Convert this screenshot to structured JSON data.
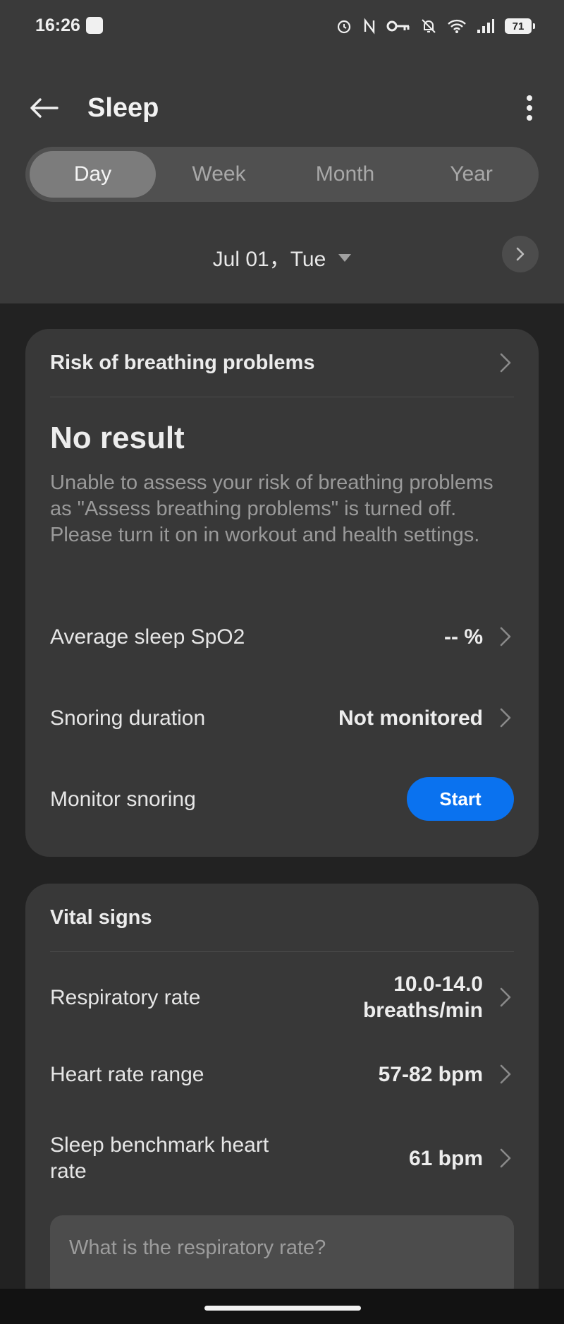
{
  "status_bar": {
    "time": "16:26",
    "battery": "71"
  },
  "header": {
    "title": "Sleep"
  },
  "tabs": [
    {
      "label": "Day",
      "active": true
    },
    {
      "label": "Week",
      "active": false
    },
    {
      "label": "Month",
      "active": false
    },
    {
      "label": "Year",
      "active": false
    }
  ],
  "date": {
    "label": "Jul 01，Tue"
  },
  "breathing_card": {
    "title": "Risk of breathing problems",
    "result": "No result",
    "description": "Unable to assess your risk of breathing problems as \"Assess breathing problems\" is turned off. Please turn it on in workout and health settings.",
    "rows": [
      {
        "label": "Average sleep SpO2",
        "value": "-- %"
      },
      {
        "label": "Snoring duration",
        "value": "Not monitored"
      }
    ],
    "monitor": {
      "label": "Monitor snoring",
      "button": "Start"
    }
  },
  "vital_card": {
    "title": "Vital signs",
    "rows": [
      {
        "label": "Respiratory rate",
        "value_line1": "10.0-14.0",
        "value_line2": "breaths/min"
      },
      {
        "label": "Heart rate range",
        "value": "57-82 bpm"
      },
      {
        "label_line1": "Sleep benchmark heart",
        "label_line2": "rate",
        "value": "61 bpm"
      }
    ],
    "faq": "What is the respiratory rate?"
  },
  "colors": {
    "accent": "#0a72ef",
    "background": "#222222",
    "card": "#383838",
    "top_area": "#3a3a3a"
  }
}
